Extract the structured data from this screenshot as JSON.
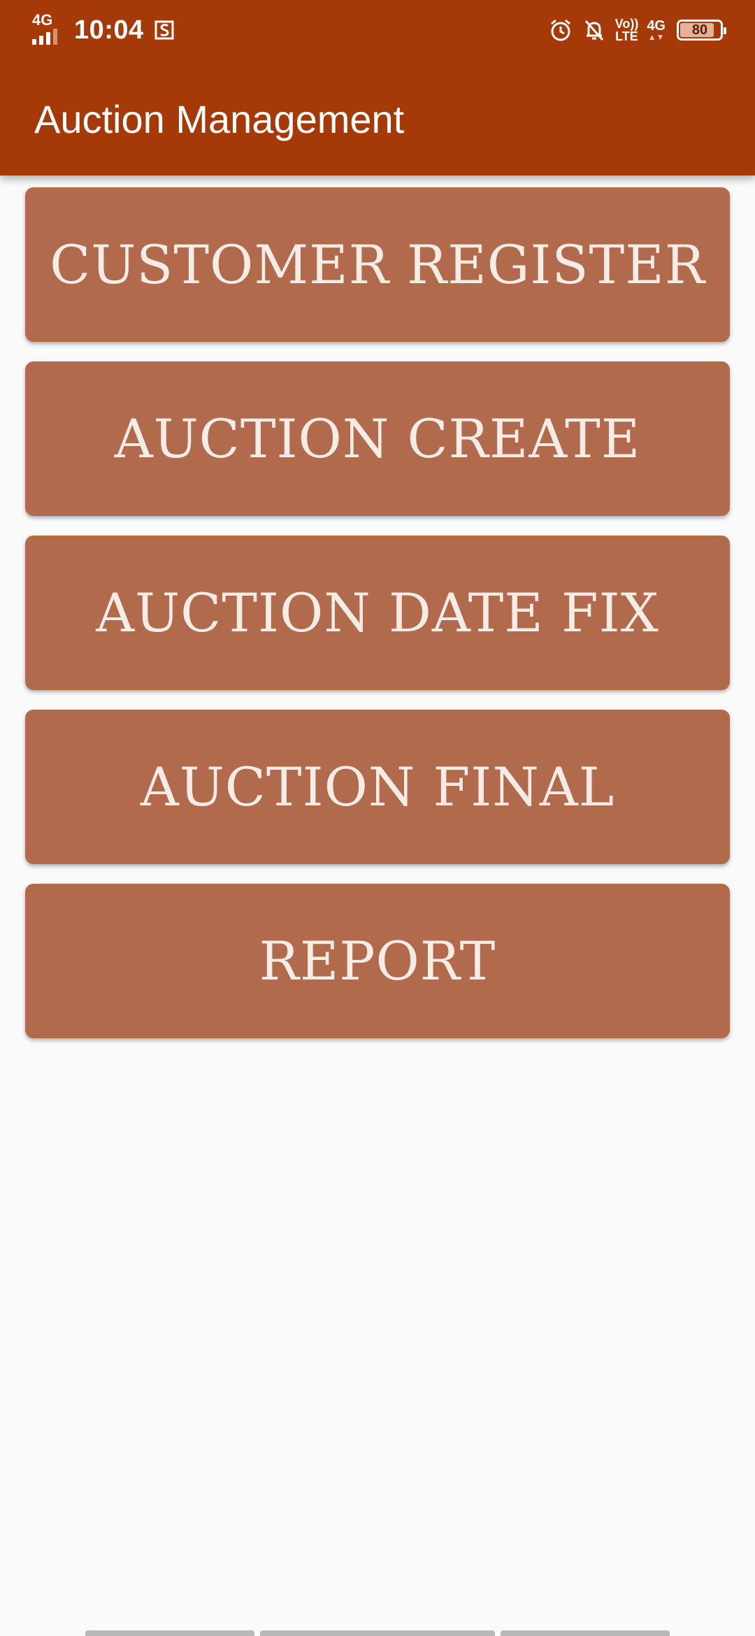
{
  "status_bar": {
    "network_type": "4G",
    "time": "10:04",
    "volte_top": "Vo))",
    "volte_bottom": "LTE",
    "data_network": "4G",
    "battery_level": "80",
    "icons": [
      "signal-icon",
      "screenshot-s-icon",
      "alarm-icon",
      "notifications-off-icon",
      "volte-icon",
      "data-arrows-icon",
      "battery-icon"
    ]
  },
  "app_bar": {
    "title": "Auction Management"
  },
  "menu": {
    "buttons": [
      {
        "label": "CUSTOMER REGISTER"
      },
      {
        "label": "AUCTION CREATE"
      },
      {
        "label": "AUCTION DATE FIX"
      },
      {
        "label": "AUCTION FINAL"
      },
      {
        "label": "REPORT"
      }
    ]
  },
  "colors": {
    "header": "#a53a08",
    "button": "#b16a4b",
    "button_text": "#f6ece6",
    "background": "#fafafa"
  }
}
